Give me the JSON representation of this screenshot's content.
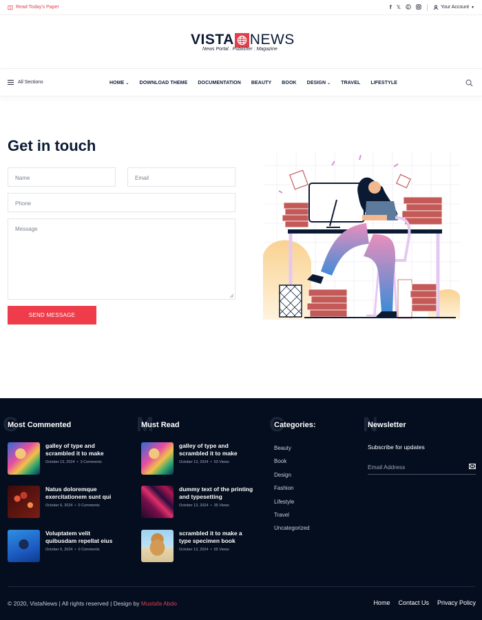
{
  "topbar": {
    "read_paper": "Read Today's Paper",
    "social": [
      "f",
      "X",
      "p",
      "ig"
    ],
    "account": "Your Account"
  },
  "logo": {
    "vista": "VISTA",
    "news": "NEWS",
    "tagline": "News Portal . Publisher . Magazine"
  },
  "nav": {
    "sections": "All Sections",
    "items": [
      "HOME",
      "DOWNLOAD THEME",
      "DOCUMENTATION",
      "BEAUTY",
      "BOOK",
      "DESIGN",
      "TRAVEL",
      "LIFESTYLE"
    ]
  },
  "contact": {
    "title": "Get in touch",
    "name_placeholder": "Name",
    "email_placeholder": "Email",
    "phone_placeholder": "Phone",
    "message_placeholder": "Message",
    "send_label": "SEND MESSAGE"
  },
  "footer": {
    "most_commented": {
      "title": "Most Commented",
      "ghost": "C",
      "posts": [
        {
          "title": "galley of type and scrambled it to make",
          "date": "October 13, 2024",
          "stat": "3 Comments"
        },
        {
          "title": "Natus doloremque exercitationem sunt qui",
          "date": "October 6, 2024",
          "stat": "0 Comments"
        },
        {
          "title": "Voluptatem velit quibusdam repellat eius",
          "date": "October 6, 2024",
          "stat": "0 Comments"
        }
      ]
    },
    "must_read": {
      "title": "Must Read",
      "ghost": "M",
      "posts": [
        {
          "title": "galley of type and scrambled it to make",
          "date": "October 13, 2024",
          "stat": "53 Views"
        },
        {
          "title": "dummy text of the printing and typesetting",
          "date": "October 13, 2024",
          "stat": "35 Views"
        },
        {
          "title": "scrambled it to make a type specimen book",
          "date": "October 13, 2024",
          "stat": "55 Views"
        }
      ]
    },
    "categories": {
      "title": "Categories:",
      "ghost": "C",
      "items": [
        "Beauty",
        "Book",
        "Design",
        "Fashion",
        "Lifestyle",
        "Travel",
        "Uncategorized"
      ]
    },
    "newsletter": {
      "title": "Newsletter",
      "ghost": "N",
      "subtitle": "Subscribe for updates",
      "email_placeholder": "Email Address"
    },
    "copyright": "© 2020, VistaNews | All rights reserved | Design by",
    "author": "Mustafa Abdo",
    "links": [
      "Home",
      "Contact Us",
      "Privacy Policy"
    ]
  },
  "colors": {
    "accent": "#e23f4d",
    "navy": "#0b1a33",
    "footer_bg": "#050e1f"
  }
}
